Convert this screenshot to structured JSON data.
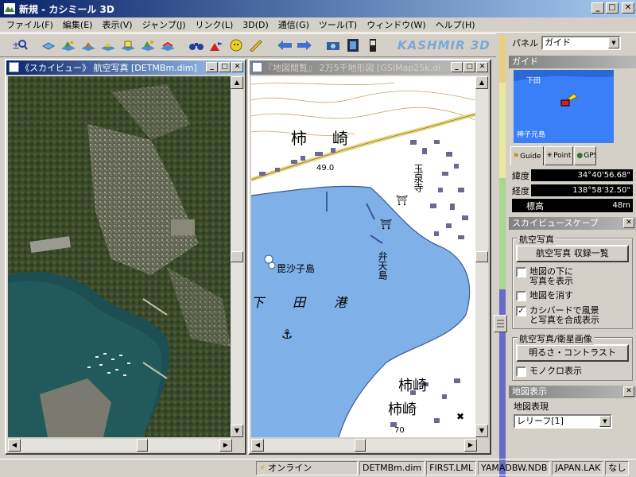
{
  "window": {
    "title": "新規 - カシミール 3D",
    "controls": {
      "minimize": "_",
      "maximize": "□",
      "close": "✕"
    }
  },
  "menu": [
    "ファイル(F)",
    "編集(E)",
    "表示(V)",
    "ジャンプ(J)",
    "リンク(L)",
    "3D(D)",
    "通信(G)",
    "ツール(T)",
    "ウィンドウ(W)",
    "ヘルプ(H)"
  ],
  "toolbar": {
    "logo": "KASHMIR 3D"
  },
  "left_window": {
    "title": "《スカイビュー》 航空写真 [DETMBm.dim]"
  },
  "right_window": {
    "title": "『地図閲覧』 2万5千地形図 [GSIMap25k.di",
    "labels": {
      "kakizaki_top": "柿　崎",
      "elev_49": "49.0",
      "gyokusenji": "玉泉寺",
      "benten": "弁天島",
      "bishamon": "毘沙子島",
      "shimodako": "下　田　港",
      "kakizaki_b1": "柿崎",
      "kakizaki_b2": "柿崎",
      "elev_70": "70"
    }
  },
  "panel": {
    "label": "パネル",
    "selected": "ガイド",
    "guide_header": "ガイド",
    "minimap": {
      "place1": "下田",
      "place2": "神子元島"
    },
    "tabs": [
      "Guide",
      "Point",
      "GPS"
    ],
    "lat_label": "緯度",
    "lat": "34°40'56.68\"",
    "lon_label": "経度",
    "lon": "138°58'32.50\"",
    "elev_label": "標高",
    "elev": "48m",
    "skyview_header": "スカイビュースケープ",
    "aerial_group": "航空写真",
    "aerial_button": "航空写真 収録一覧",
    "check_under_map": "地図の下に写真を表示",
    "check_hide_map": "地図を消す",
    "check_kashbird": "カシバードで風景と写真を合成表示",
    "sat_group": "航空写真/衛星画像",
    "brightness_button": "明るさ・コントラスト",
    "check_mono": "モノクロ表示",
    "mapdisp_header": "地図表現",
    "mapdisp_title": "地図表示",
    "relief_select": "レリーフ[1]"
  },
  "status": {
    "online": "オンライン",
    "panes": [
      "DETMBm.dim",
      "FIRST.LML",
      "YAMADBW.NDB",
      "JAPAN.LAK",
      "なし"
    ]
  },
  "colors": {
    "title_active": "#0a246a",
    "title_gradient": "#a6caf0",
    "face": "#d4d0c8",
    "sea_map": "#7fb0e8",
    "sea_photo": "#1e5a5a"
  }
}
